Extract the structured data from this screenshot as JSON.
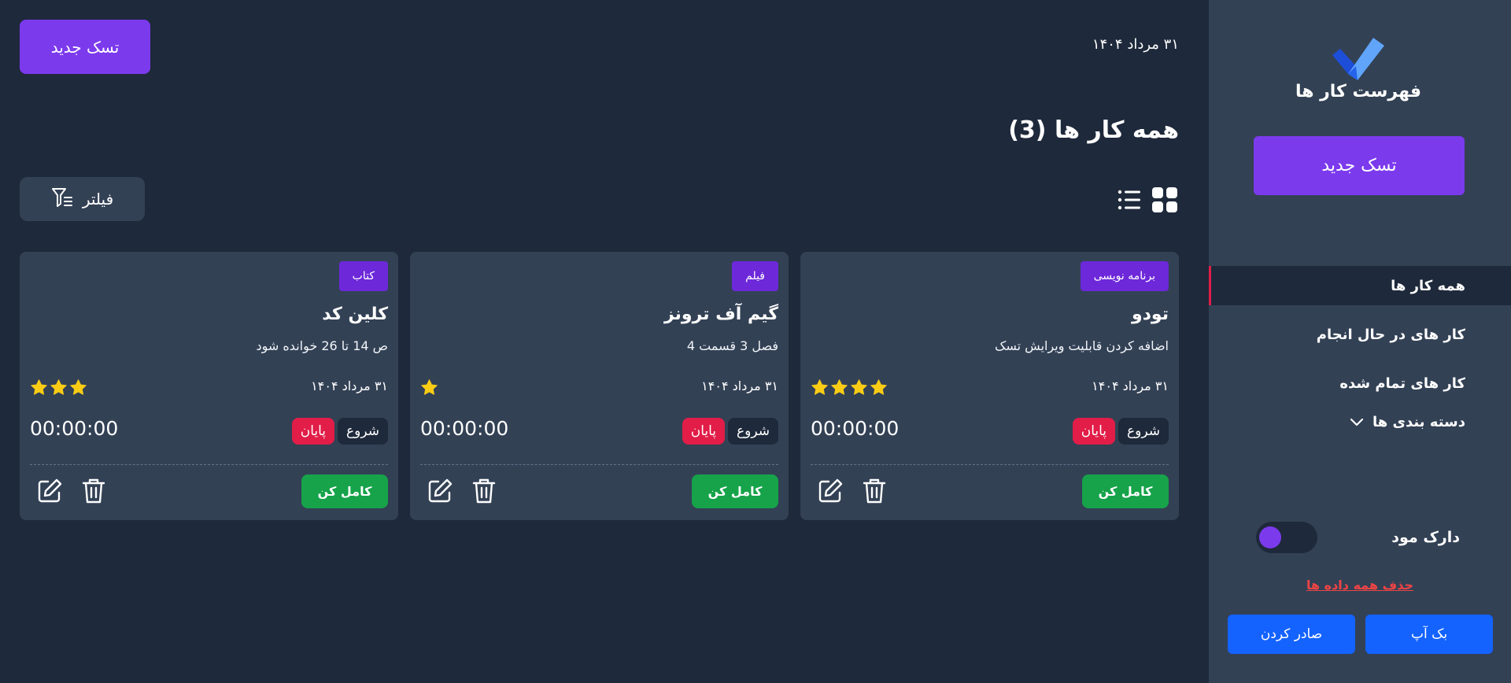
{
  "header": {
    "date": "۳۱ مرداد ۱۴۰۴",
    "new_task_label": "تسک جدید",
    "page_title": "همه کار ها (3)",
    "filter_label": "فیلتر"
  },
  "sidebar": {
    "app_title": "فهرست کار ها",
    "new_task_label": "تسک جدید",
    "nav": [
      {
        "label": "همه کار ها",
        "active": true
      },
      {
        "label": "کار های در حال انجام"
      },
      {
        "label": "کار های تمام شده"
      },
      {
        "label": "دسته بندی ها"
      }
    ],
    "dark_mode_label": "دارک مود",
    "delete_all_label": "حذف همه داده ها",
    "backup_label": "بک آپ",
    "export_label": "صادر کردن"
  },
  "cards": [
    {
      "category": "برنامه نویسی",
      "title": "تودو",
      "description": "اضافه کردن قابلیت ویرایش تسک",
      "date": "۳۱ مرداد ۱۴۰۴",
      "stars": 4,
      "start_label": "شروع",
      "end_label": "پایان",
      "timer": "00:00:00",
      "complete_label": "کامل کن"
    },
    {
      "category": "فیلم",
      "title": "گیم آف ترونز",
      "description": "فصل 3 قسمت 4",
      "date": "۳۱ مرداد ۱۴۰۴",
      "stars": 1,
      "start_label": "شروع",
      "end_label": "پایان",
      "timer": "00:00:00",
      "complete_label": "کامل کن"
    },
    {
      "category": "کتاب",
      "title": "کلین کد",
      "description": "ص 14 تا 26 خوانده شود",
      "date": "۳۱ مرداد ۱۴۰۴",
      "stars": 3,
      "start_label": "شروع",
      "end_label": "پایان",
      "timer": "00:00:00",
      "complete_label": "کامل کن"
    }
  ],
  "icons": [
    "checkmark-logo-icon",
    "grid-view-icon",
    "list-view-icon",
    "filter-icon",
    "chevron-down-icon",
    "star-icon",
    "edit-icon",
    "trash-icon"
  ],
  "colors": {
    "background": "#1e293b",
    "panel": "#334155",
    "accent_purple": "#7c3aed",
    "badge_purple": "#6d28d9",
    "complete_green": "#16a34a",
    "end_red": "#e11d48",
    "action_blue": "#1463ff",
    "star_yellow": "#facc15"
  }
}
